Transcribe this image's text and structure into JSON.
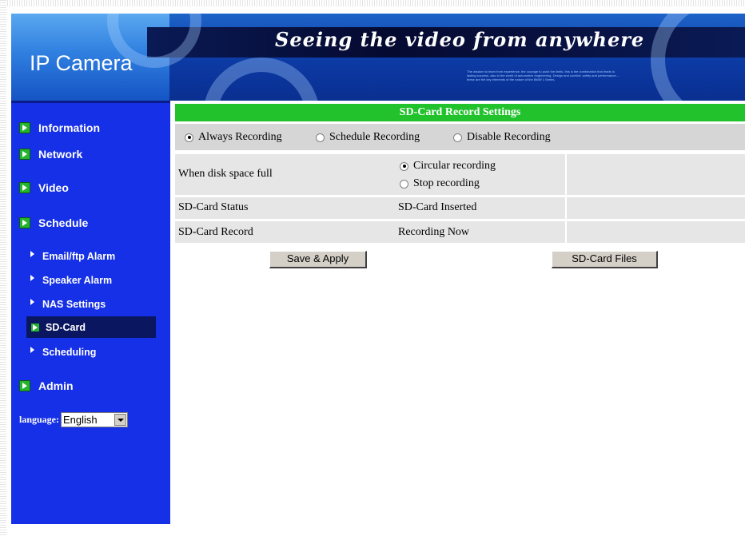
{
  "banner": {
    "brand": "IP Camera",
    "slogan": "Seeing the video from anywhere",
    "fine_print": "The wisdom to learn from experience, the courage to push the limits, this is the combination that leads to lasting success, also in the world of automotive engineering. Design and comfort, safety and performance – these are the key elements of the nature of the BMW 1 Series."
  },
  "sidebar": {
    "items": [
      {
        "label": "Information"
      },
      {
        "label": "Network"
      },
      {
        "label": "Video"
      },
      {
        "label": "Schedule"
      },
      {
        "label": "Admin"
      }
    ],
    "sub_items": [
      {
        "label": "Email/ftp Alarm"
      },
      {
        "label": "Speaker Alarm"
      },
      {
        "label": "NAS Settings"
      },
      {
        "label": "SD-Card"
      },
      {
        "label": "Scheduling"
      }
    ],
    "active_sub_item": "SD-Card",
    "language_label": "language:",
    "language_value": "English"
  },
  "settings": {
    "title": "SD-Card Record Settings",
    "modes": [
      {
        "label": "Always Recording",
        "checked": true
      },
      {
        "label": "Schedule Recording",
        "checked": false
      },
      {
        "label": "Disable Recording",
        "checked": false
      }
    ],
    "disk_full": {
      "label": "When disk space full",
      "options": [
        {
          "label": "Circular recording",
          "checked": true
        },
        {
          "label": "Stop recording",
          "checked": false
        }
      ]
    },
    "status": {
      "label": "SD-Card Status",
      "value": "SD-Card Inserted"
    },
    "record": {
      "label": "SD-Card Record",
      "value": "Recording Now"
    },
    "save_label": "Save & Apply",
    "files_label": "SD-Card Files"
  }
}
